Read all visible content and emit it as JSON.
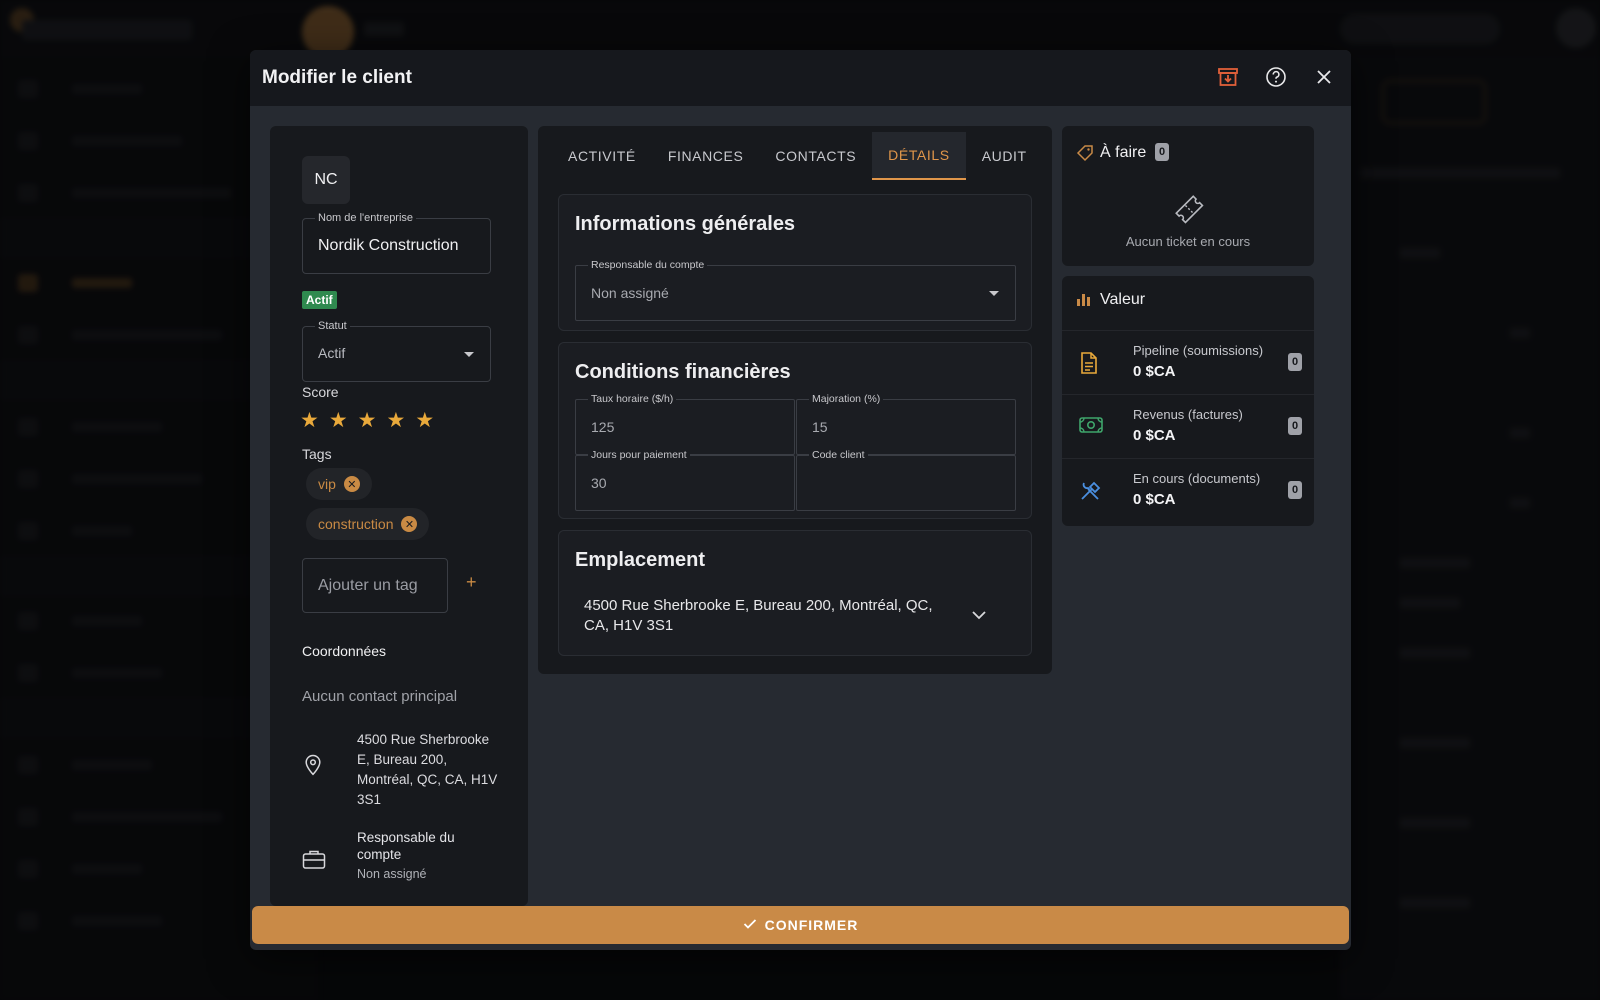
{
  "modal": {
    "title": "Modifier le client",
    "confirm_label": "CONFIRMER"
  },
  "client": {
    "initials": "NC",
    "company_label": "Nom de l'entreprise",
    "company_name": "Nordik Construction",
    "status_badge": "Actif",
    "status_label": "Statut",
    "status_value": "Actif",
    "score_label": "Score",
    "score_value": 5,
    "score_max": 5,
    "tags_label": "Tags",
    "tags": [
      "vip",
      "construction"
    ],
    "tag_input_placeholder": "Ajouter un tag",
    "add_tag_symbol": "+",
    "coordinates_title": "Coordonnées",
    "no_primary_contact": "Aucun contact principal",
    "address": "4500 Rue Sherbrooke E, Bureau 200, Montréal, QC, CA, H1V 3S1",
    "account_manager_label": "Responsable du compte",
    "account_manager_value": "Non assigné"
  },
  "tabs": [
    {
      "label": "ACTIVITÉ",
      "active": false
    },
    {
      "label": "FINANCES",
      "active": false
    },
    {
      "label": "CONTACTS",
      "active": false
    },
    {
      "label": "DÉTAILS",
      "active": true
    },
    {
      "label": "AUDIT",
      "active": false
    }
  ],
  "details": {
    "general_title": "Informations générales",
    "account_manager_label": "Responsable du compte",
    "account_manager_value": "Non assigné",
    "financial_title": "Conditions financières",
    "hourly_rate_label": "Taux horaire ($/h)",
    "hourly_rate_value": "125",
    "markup_label": "Majoration (%)",
    "markup_value": "15",
    "payment_days_label": "Jours pour paiement",
    "payment_days_value": "30",
    "client_code_label": "Code client",
    "client_code_value": "",
    "location_title": "Emplacement",
    "location_address": "4500 Rue Sherbrooke E, Bureau 200, Montréal, QC, CA, H1V 3S1"
  },
  "todo": {
    "title": "À faire",
    "count": "0",
    "empty_text": "Aucun ticket en cours"
  },
  "value": {
    "title": "Valeur",
    "rows": [
      {
        "label": "Pipeline (soumissions)",
        "amount": "0 $CA",
        "count": "0",
        "icon": "document-icon"
      },
      {
        "label": "Revenus (factures)",
        "amount": "0 $CA",
        "count": "0",
        "icon": "cash-icon"
      },
      {
        "label": "En cours (documents)",
        "amount": "0 $CA",
        "count": "0",
        "icon": "tools-icon"
      }
    ]
  },
  "colors": {
    "accent": "#c98a47",
    "active_badge": "#2f8a4f",
    "star": "#e9a93b",
    "archive_icon": "#e0603a"
  }
}
